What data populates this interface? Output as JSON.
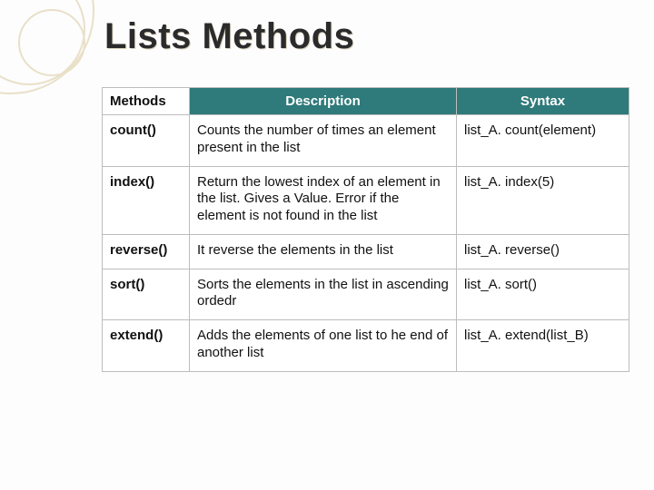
{
  "title": "Lists Methods",
  "table": {
    "headers": {
      "method": "Methods",
      "description": "Description",
      "syntax": "Syntax"
    },
    "rows": [
      {
        "method": "count()",
        "description": "Counts the number of times an element present in the list",
        "syntax": "list_A. count(element)"
      },
      {
        "method": "index()",
        "description": "Return the lowest index of an element in the list. Gives a Value. Error if the element is not found in the list",
        "syntax": "list_A. index(5)"
      },
      {
        "method": "reverse()",
        "description": "It reverse the elements in the list",
        "syntax": "list_A. reverse()"
      },
      {
        "method": "sort()",
        "description": "Sorts the elements in the list in ascending ordedr",
        "syntax": "list_A. sort()"
      },
      {
        "method": "extend()",
        "description": "Adds the elements of one list to he end of another list",
        "syntax": "list_A. extend(list_B)"
      }
    ]
  }
}
